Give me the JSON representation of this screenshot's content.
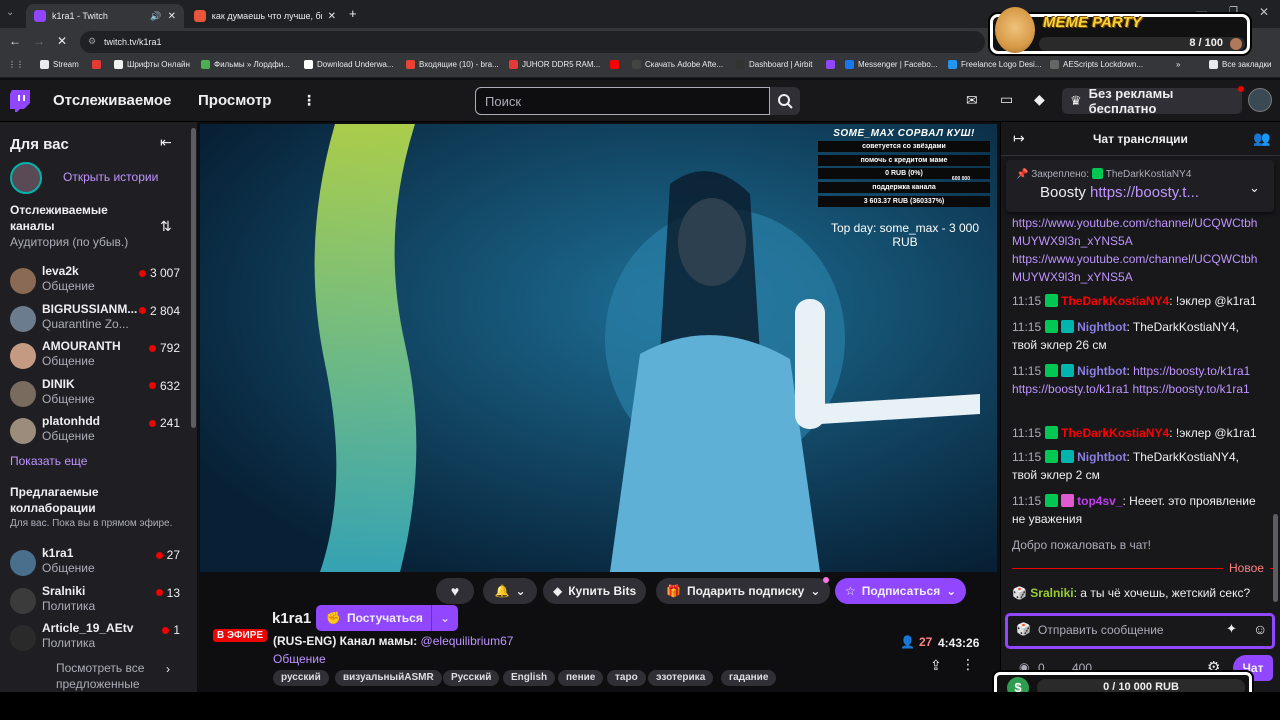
{
  "browser": {
    "tabs": [
      {
        "title": "k1ra1 - Twitch",
        "active": true
      },
      {
        "title": "как думаешь что лучше, быть",
        "active": false
      }
    ],
    "url": "twitch.tv/k1ra1",
    "bookmarks": [
      "Stream",
      "Шрифты Онлайн",
      "Фильмы » Лордфи...",
      "Download Underwa...",
      "Входящие (10) - bra...",
      "JUHOR DDR5 RAM...",
      "Скачать Adobe Afte...",
      "Dashboard | Airbit",
      "Messenger | Facebo...",
      "Freelance Logo Desi...",
      "AEScripts Lockdown...",
      "Все закладки"
    ]
  },
  "overlay_top": {
    "title": "MEME PARTY",
    "counter": "8 / 100"
  },
  "nav": {
    "following": "Отслеживаемое",
    "browse": "Просмотр",
    "search_placeholder": "Поиск",
    "ad_free": "Без рекламы бесплатно"
  },
  "sidebar": {
    "for_you": "Для вас",
    "open_stories": "Открыть истории",
    "followed_title": "Отслеживаемые каналы",
    "followed_sub": "Аудитория (по убыв.)",
    "followed": [
      {
        "name": "leva2k",
        "category": "Общение",
        "viewers": "3 007",
        "color": "#8a6a55"
      },
      {
        "name": "BIGRUSSIANM...",
        "category": "Quarantine Zo...",
        "viewers": "2 804",
        "color": "#6b7c8f"
      },
      {
        "name": "AMOURANTH",
        "category": "Общение",
        "viewers": "792",
        "color": "#c59a83"
      },
      {
        "name": "DINIK",
        "category": "Общение",
        "viewers": "632",
        "color": "#7a6b5f"
      },
      {
        "name": "platonhdd",
        "category": "Общение",
        "viewers": "241",
        "color": "#9b8c7c"
      }
    ],
    "show_more": "Показать еще",
    "collab_title": "Предлагаемые коллаборации",
    "collab_sub": "Для вас. Пока вы в прямом эфире.",
    "collabs": [
      {
        "name": "k1ra1",
        "category": "Общение",
        "viewers": "27",
        "color": "#4a6f8c"
      },
      {
        "name": "Sralniki",
        "category": "Политика",
        "viewers": "13",
        "color": "#3b3b3b"
      },
      {
        "name": "Article_19_AEtv",
        "category": "Политика",
        "viewers": "1",
        "color": "#2a2a2a"
      }
    ],
    "view_all": "Посмотреть все предложенные"
  },
  "stream_overlay": {
    "header": "SOME_MAX СОРВАЛ КУШ!",
    "rows": [
      "советуется со звёздами",
      "помочь с кредитом маме",
      "0 RUB (0%)",
      "поддержка канала",
      "3 603.37 RUB (360337%)"
    ],
    "small_value": "600 000",
    "top_day": "Top day: some_max - 3 000 RUB"
  },
  "channel": {
    "name": "k1ra1",
    "live_badge": "В ЭФИРЕ",
    "knock": "Постучаться",
    "title_prefix": "(RUS-ENG) Канал мамы: ",
    "title_link": "@elequilibrium67",
    "category": "Общение",
    "viewers": "27",
    "uptime": "4:43:26",
    "tags": [
      "русский",
      "визуальныйASMR",
      "Русский",
      "English",
      "пение",
      "таро",
      "эзотерика",
      "гадание"
    ],
    "buy_bits": "Купить Bits",
    "gift_sub": "Подарить подписку",
    "subscribe": "Подписаться"
  },
  "chat": {
    "title": "Чат трансляции",
    "pinned_label": "Закреплено:",
    "pinned_user": "TheDarkKostiaNY4",
    "pinned_text": "Boosty ",
    "pinned_link": "https://boosty.t...",
    "link1": "https://www.youtube.com/channel/UCQWCtbhMUYWX9l3n_xYNS5A",
    "link2": "https://www.youtube.com/channel/UCQWCtbhMUYWX9l3n_xYNS5A",
    "messages": [
      {
        "time": "11:15",
        "user": "TheDarkKostiaNY4",
        "color": "#ff0000",
        "text": ": !эклер @k1ra1"
      },
      {
        "time": "11:15",
        "user": "Nightbot",
        "color": "#8a7ee0",
        "text": ": TheDarkKostiaNY4, твой эклер 26 см"
      },
      {
        "time": "11:15",
        "user": "Nightbot",
        "color": "#8a7ee0",
        "text": ": ",
        "link": "https://boosty.to/k1ra1 https://boosty.to/k1ra1 https://boosty.to/k1ra1"
      },
      {
        "time": "11:15",
        "user": "TheDarkKostiaNY4",
        "color": "#ff0000",
        "text": ": !эклер @k1ra1"
      },
      {
        "time": "11:15",
        "user": "Nightbot",
        "color": "#8a7ee0",
        "text": ": TheDarkKostiaNY4, твой эклер 2 см"
      },
      {
        "time": "11:15",
        "user": "top4sv_",
        "color": "#c23cf0",
        "text": ": Нееет. это проявление не уважения"
      }
    ],
    "welcome": "Добро пожаловать в чат!",
    "new_label": "Новое",
    "last_user": "Sralniki",
    "last_text": ": а ты чё хочешь, жетский секс?",
    "input_placeholder": "Отправить сообщение",
    "points": "0",
    "bits": "400",
    "chat_button": "Чат"
  },
  "overlay_bottom": {
    "goal": "0 / 10 000 RUB"
  }
}
